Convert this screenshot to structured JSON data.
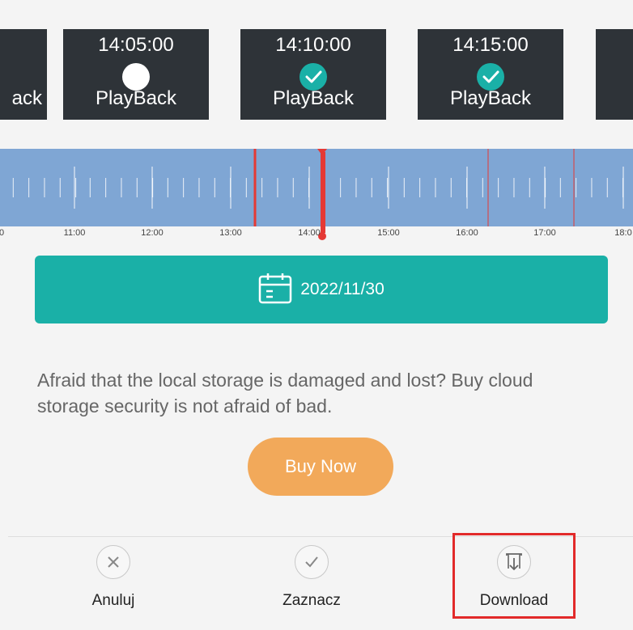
{
  "clips": [
    {
      "time": "",
      "label": "ack",
      "mark": "none"
    },
    {
      "time": "14:05:00",
      "label": "PlayBack",
      "mark": "unchecked"
    },
    {
      "time": "14:10:00",
      "label": "PlayBack",
      "mark": "checked"
    },
    {
      "time": "14:15:00",
      "label": "PlayBack",
      "mark": "checked"
    },
    {
      "time": "",
      "label": "",
      "mark": "none"
    }
  ],
  "timeline": {
    "tick_labels": [
      "0",
      "11:00",
      "12:00",
      "13:00",
      "14:00",
      "15:00",
      "16:00",
      "17:00",
      "18:0"
    ],
    "colors": {
      "track": "#7fa6d4",
      "recording": "#e53935",
      "cursor": "#e53935"
    }
  },
  "date_picker": {
    "icon": "calendar-icon",
    "date": "2022/11/30"
  },
  "promo": {
    "text": "Afraid that the local storage is damaged and lost? Buy cloud storage security is not afraid of bad.",
    "buy_button": "Buy Now"
  },
  "actions": [
    {
      "icon": "close-icon",
      "label": "Anuluj"
    },
    {
      "icon": "check-icon",
      "label": "Zaznacz"
    },
    {
      "icon": "download-icon",
      "label": "Download"
    }
  ],
  "colors": {
    "accent": "#1ab0a7",
    "buy": "#f2a95a",
    "highlight": "#e22a2a"
  }
}
